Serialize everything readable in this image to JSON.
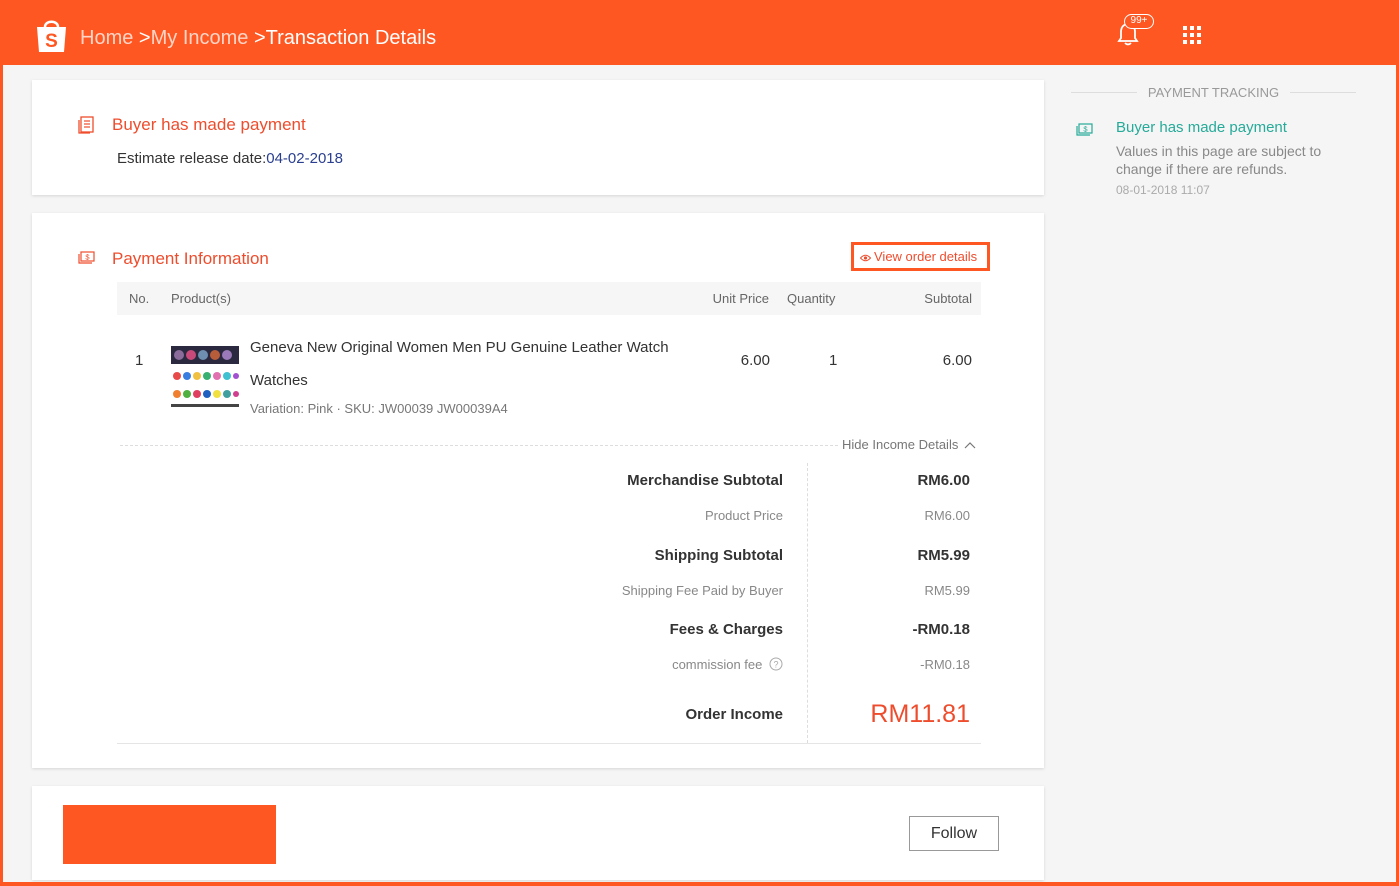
{
  "header": {
    "breadcrumb": [
      {
        "label": "Home",
        "sep": ">"
      },
      {
        "label": "My Income",
        "sep": ">"
      },
      {
        "label": "Transaction Details"
      }
    ],
    "notification_badge": "99+",
    "icons": {
      "logo": "shopee-bag-icon",
      "bell": "bell-icon",
      "apps": "apps-grid-icon"
    }
  },
  "status_card": {
    "title": "Buyer has made payment",
    "release_label": "Estimate release date:",
    "release_date": "04-02-2018"
  },
  "payment_info": {
    "title": "Payment Information",
    "view_order_label": "View order details",
    "columns": {
      "no": "No.",
      "product": "Product(s)",
      "unit_price": "Unit Price",
      "quantity": "Quantity",
      "subtotal": "Subtotal"
    },
    "items": [
      {
        "no": "1",
        "name": "Geneva New Original Women Men PU Genuine Leather Watch Watches",
        "variation": "Variation: Pink · SKU: JW00039 JW00039A4",
        "unit_price": "6.00",
        "quantity": "1",
        "subtotal": "6.00"
      }
    ],
    "toggle_label": "Hide Income Details",
    "income": {
      "merch_label": "Merchandise Subtotal",
      "merch_value": "RM6.00",
      "product_price_label": "Product Price",
      "product_price_value": "RM6.00",
      "shipping_label": "Shipping Subtotal",
      "shipping_value": "RM5.99",
      "shipping_fee_label": "Shipping Fee Paid by Buyer",
      "shipping_fee_value": "RM5.99",
      "fees_label": "Fees & Charges",
      "fees_value": "-RM0.18",
      "commission_label": "commission fee",
      "commission_value": "-RM0.18",
      "order_income_label": "Order Income",
      "order_income_value": "RM11.81"
    }
  },
  "shop_card": {
    "follow_label": "Follow"
  },
  "tracking": {
    "heading": "PAYMENT TRACKING",
    "event_title": "Buyer has made payment",
    "event_desc": "Values in this page are subject to change if there are refunds.",
    "event_time": "08-01-2018 11:07"
  },
  "colors": {
    "brand": "#ff5722",
    "accent_text": "#ee4d2d",
    "tracking_green": "#26aa99",
    "date_blue": "#2a3f8f"
  }
}
